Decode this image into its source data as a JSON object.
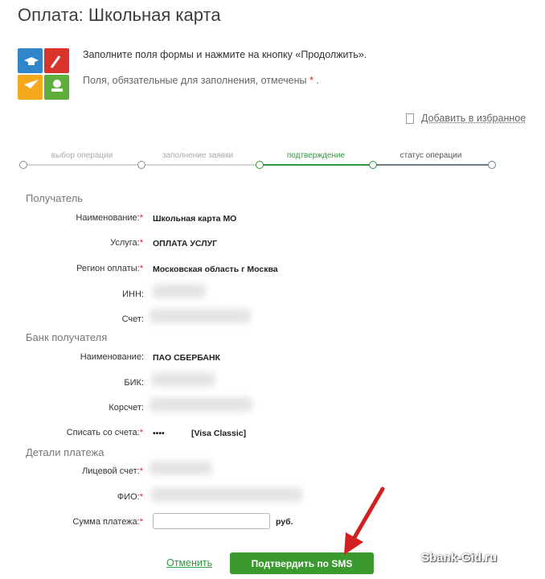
{
  "page": {
    "title": "Оплата: Школьная карта"
  },
  "intro": {
    "line1": "Заполните поля формы и нажмите на кнопку «Продолжить».",
    "line2": "Поля, обязательные для заполнения, отмечены",
    "required_mark": "*",
    "line2_end": "."
  },
  "favorites": {
    "label": "Добавить в избранное"
  },
  "steps": [
    {
      "label": "выбор операции",
      "state": "done"
    },
    {
      "label": "заполнение заявки",
      "state": "done"
    },
    {
      "label": "подтверждение",
      "state": "active"
    },
    {
      "label": "статус операции",
      "state": "pending"
    }
  ],
  "recipient": {
    "section": "Получатель",
    "name_label": "Наименование:",
    "name_value": "Школьная карта МО",
    "service_label": "Услуга:",
    "service_value": "ОПЛАТА УСЛУГ",
    "region_label": "Регион оплаты:",
    "region_value": "Московская область г Москва",
    "inn_label": "ИНН:",
    "account_label": "Счет:"
  },
  "bank": {
    "section": "Банк получателя",
    "name_label": "Наименование:",
    "name_value": "ПАО СБЕРБАНК",
    "bik_label": "БИК:",
    "corr_label": "Корсчет:",
    "debit_label": "Списать со счета:",
    "debit_mask": "••••",
    "debit_card": "[Visa Classic]"
  },
  "details": {
    "section": "Детали платежа",
    "personal_label": "Лицевой счет:",
    "fio_label": "ФИО:",
    "amount_label": "Сумма платежа:",
    "amount_value": "",
    "currency": "руб."
  },
  "required_mark": "*",
  "actions": {
    "cancel": "Отменить",
    "confirm": "Подтвердить по SMS"
  },
  "watermark": "Sbank-Gid.ru",
  "colors": {
    "accent": "#3a9a2f",
    "arrow": "#d21f1f",
    "required": "#d22222"
  }
}
